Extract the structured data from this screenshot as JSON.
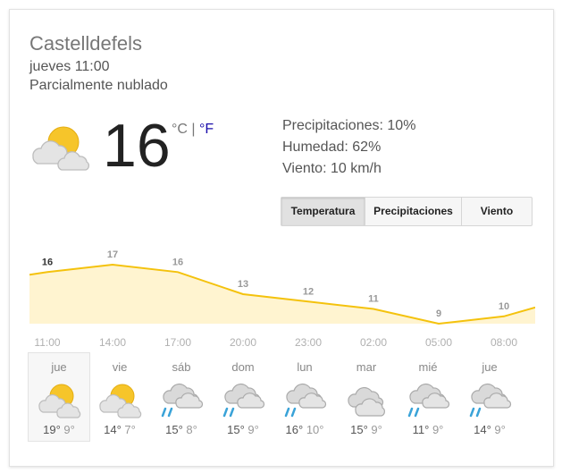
{
  "location": "Castelldefels",
  "datetime": "jueves 11:00",
  "condition": "Parcialmente nublado",
  "current": {
    "temperature": "16",
    "unit_c": "°C",
    "separator": "|",
    "unit_f": "°F",
    "icon": "partly-cloudy-icon"
  },
  "stats": {
    "precipitation": "Precipitaciones: 10%",
    "humidity": "Humedad: 62%",
    "wind": "Viento: 10 km/h"
  },
  "tabs": [
    {
      "label": "Temperatura",
      "active": true
    },
    {
      "label": "Precipitaciones",
      "active": false
    },
    {
      "label": "Viento",
      "active": false
    }
  ],
  "chart_data": {
    "type": "area",
    "x": [
      "11:00",
      "14:00",
      "17:00",
      "20:00",
      "23:00",
      "02:00",
      "05:00",
      "08:00"
    ],
    "values": [
      16,
      17,
      16,
      13,
      12,
      11,
      9,
      10
    ],
    "fill_color": "#fff4d0",
    "line_color": "#f4c20d"
  },
  "forecast": [
    {
      "day": "jue",
      "high": "19°",
      "low": "9°",
      "icon": "partly-cloudy-icon",
      "selected": true
    },
    {
      "day": "vie",
      "high": "14°",
      "low": "7°",
      "icon": "partly-cloudy-icon",
      "selected": false
    },
    {
      "day": "sáb",
      "high": "15°",
      "low": "8°",
      "icon": "rain-icon",
      "selected": false
    },
    {
      "day": "dom",
      "high": "15°",
      "low": "9°",
      "icon": "rain-icon",
      "selected": false
    },
    {
      "day": "lun",
      "high": "16°",
      "low": "10°",
      "icon": "rain-icon",
      "selected": false
    },
    {
      "day": "mar",
      "high": "15°",
      "low": "9°",
      "icon": "cloudy-icon",
      "selected": false
    },
    {
      "day": "mié",
      "high": "11°",
      "low": "9°",
      "icon": "rain-icon",
      "selected": false
    },
    {
      "day": "jue",
      "high": "14°",
      "low": "9°",
      "icon": "rain-icon",
      "selected": false
    }
  ]
}
